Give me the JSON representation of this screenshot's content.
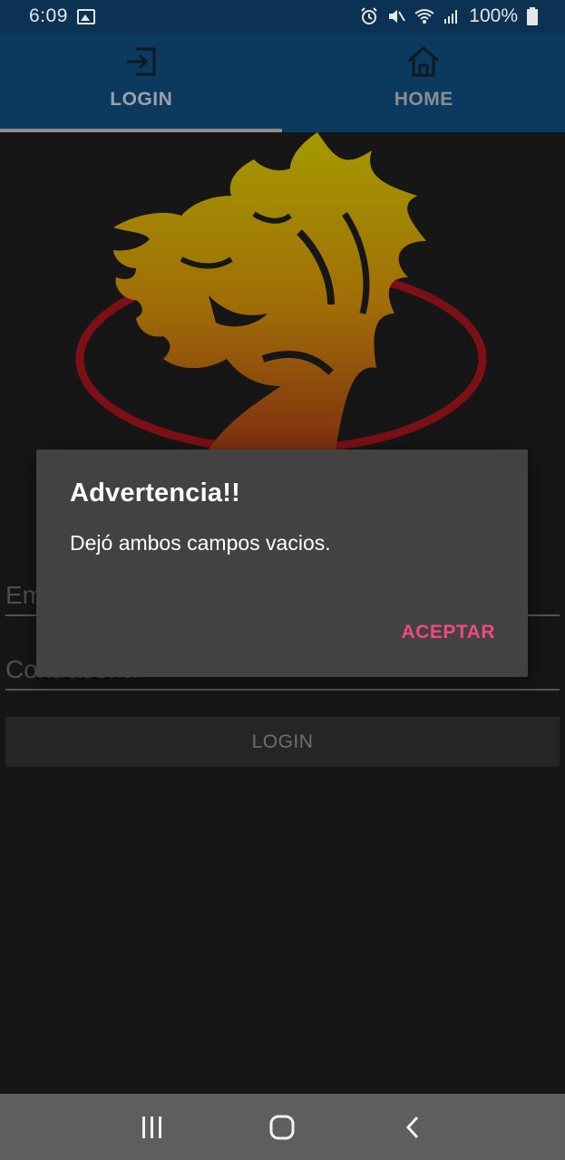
{
  "status_bar": {
    "time": "6:09",
    "battery_percent": "100%",
    "icons": [
      "image-icon",
      "alarm-icon",
      "mute-icon",
      "wifi-icon",
      "signal-icon",
      "battery-icon"
    ]
  },
  "tabs": [
    {
      "label": "LOGIN",
      "icon": "login-icon",
      "active": true
    },
    {
      "label": "HOME",
      "icon": "home-icon",
      "active": false
    }
  ],
  "form": {
    "email_placeholder": "Email",
    "password_placeholder": "Contraseña",
    "login_button": "LOGIN"
  },
  "dialog": {
    "title": "Advertencia!!",
    "message": "Dejó ambos campos vacios.",
    "accept_button": "ACEPTAR"
  },
  "colors": {
    "status_bar": "#0c3253",
    "tab_bar": "#0b3a5e",
    "background": "#161616",
    "dialog_bg": "#424242",
    "accent": "#f0487f",
    "logo_ring": "#8b1118",
    "logo_gold": "#b8a000"
  },
  "nav_bar": {
    "buttons": [
      "recents-icon",
      "home-circle-icon",
      "back-icon"
    ]
  }
}
